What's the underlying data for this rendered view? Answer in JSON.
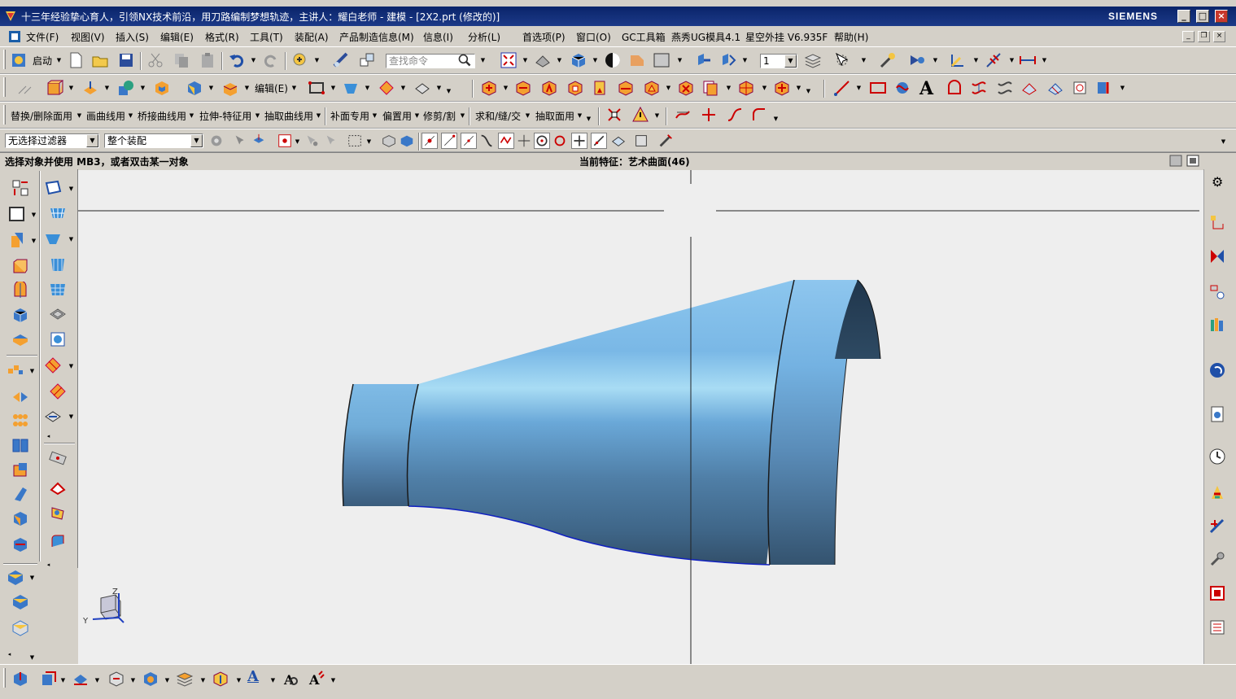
{
  "window": {
    "title": "十三年经验挚心育人，引领NX技术前沿，用刀路编制梦想轨迹，主讲人：耀白老师 - 建模 - [2X2.prt (修改的)]",
    "brand": "SIEMENS",
    "minimize": "_",
    "maximize": "□",
    "close": "×"
  },
  "menu": {
    "items": [
      "文件(F)",
      "视图(V)",
      "插入(S)",
      "编辑(E)",
      "格式(R)",
      "工具(T)",
      "装配(A)",
      "产品制造信息(M)",
      "信息(I)",
      "分析(L)",
      "首选项(P)",
      "窗口(O)",
      "GC工具箱",
      "燕秀UG模具4.1",
      "星空外挂 V6.935F",
      "帮助(H)"
    ]
  },
  "toolbar1": {
    "start": "启动",
    "search_placeholder": "查找命令",
    "layer_value": "1"
  },
  "toolbar2": {
    "edit": "编辑(E)"
  },
  "toolbar3": {
    "menus": [
      "替换/删除面用",
      "画曲线用",
      "桥接曲线用",
      "拉伸-特征用",
      "抽取曲线用",
      "补面专用",
      "偏置用",
      "修剪/割",
      "求和/缝/交",
      "抽取面用"
    ]
  },
  "selection": {
    "filter": "无选择过滤器",
    "scope": "整个装配"
  },
  "status": {
    "prompt": "选择对象并使用 MB3，或者双击某一对象",
    "feature": "当前特征：艺术曲面(46)"
  },
  "triad": {
    "z": "Z",
    "y": "Y"
  },
  "colors": {
    "titlebar": "#0a246a",
    "chrome": "#d4d0c8",
    "viewport": "#eeeeee",
    "model_light": "#7fbce8",
    "model_dark": "#2f4e68"
  }
}
